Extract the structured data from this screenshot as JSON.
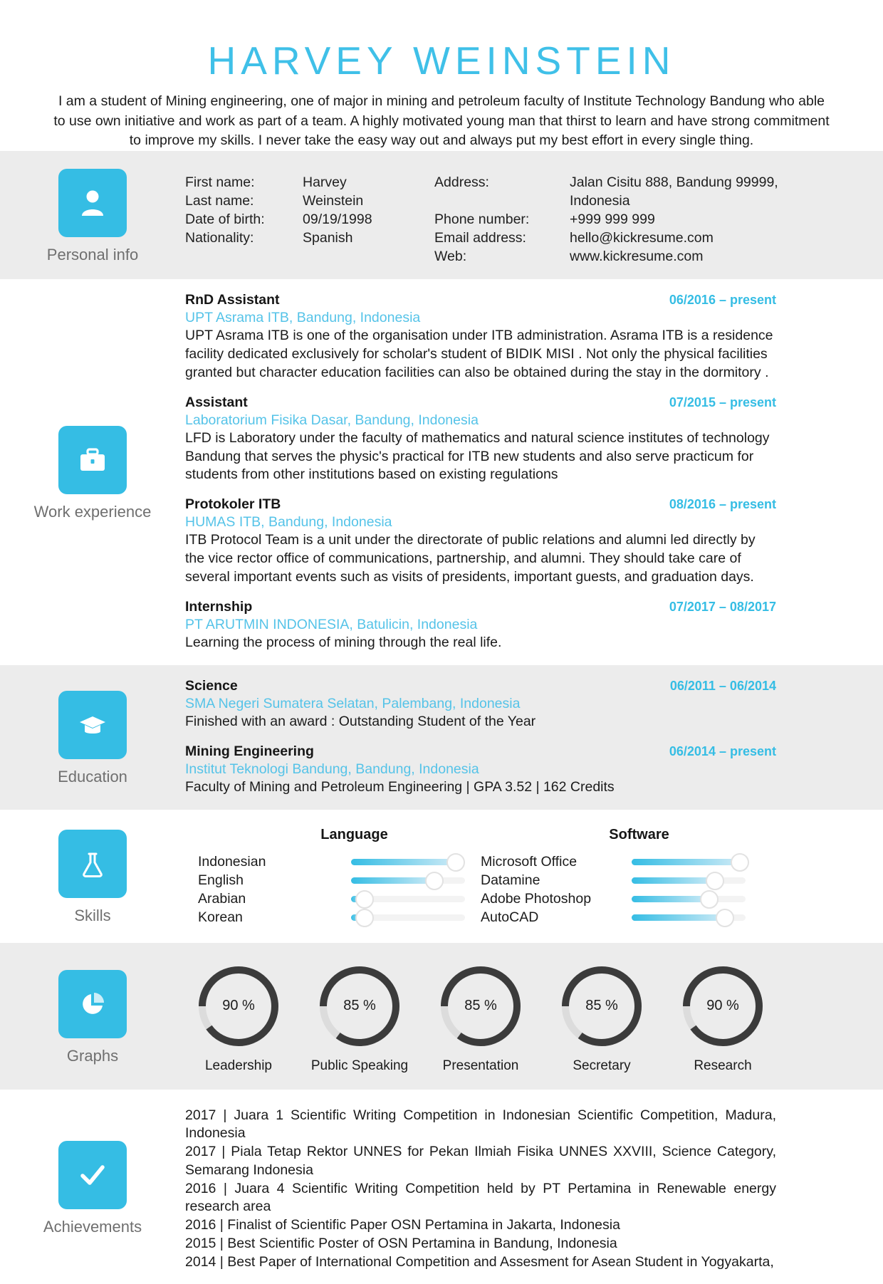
{
  "header": {
    "full_name": "HARVEY WEINSTEIN",
    "summary": "I am a student of Mining engineering, one of major in mining and petroleum faculty of Institute Technology Bandung who able to use own initiative and work as part of a team. A highly motivated young man that thirst to learn and have strong commitment to improve my skills. I never take the easy way out and always put my best effort in every single thing."
  },
  "accent_color": "#35bde4",
  "sections": {
    "personal_info": {
      "label": "Personal info",
      "icon": "person-icon",
      "left_labels": [
        "First name:",
        "Last name:",
        "Date of birth:",
        "Nationality:"
      ],
      "left_values": [
        "Harvey",
        "Weinstein",
        "09/19/1998",
        "Spanish"
      ],
      "right_labels": [
        "Address:",
        "",
        "Phone number:",
        "Email address:",
        "Web:"
      ],
      "right_values": [
        "Jalan Cisitu 888, Bandung 99999,",
        "Indonesia",
        "+999 999 999",
        "hello@kickresume.com",
        "www.kickresume.com"
      ]
    },
    "work_experience": {
      "label": "Work experience",
      "icon": "briefcase-icon",
      "entries": [
        {
          "title": "RnD Assistant",
          "date": "06/2016 – present",
          "org": "UPT Asrama ITB, Bandung, Indonesia",
          "desc": "UPT Asrama ITB is one of the organisation under ITB administration. Asrama ITB is a residence facility dedicated exclusively for scholar's student of BIDIK MISI . Not only the physical facilities granted but character education facilities can also be obtained during the stay in the dormitory ."
        },
        {
          "title": "Assistant",
          "date": "07/2015 – present",
          "org": "Laboratorium Fisika Dasar, Bandung, Indonesia",
          "desc": "LFD is Laboratory under the faculty of mathematics and natural science institutes of technology Bandung that serves the physic's practical for ITB new students and also serve practicum for students from other institutions based on existing regulations"
        },
        {
          "title": "Protokoler ITB",
          "date": "08/2016 – present",
          "org": "HUMAS ITB, Bandung, Indonesia",
          "desc": "ITB Protocol Team is a unit under the directorate of public relations and alumni led directly by the vice rector office of communications, partnership, and alumni. They should take care of several important events such as visits of presidents, important guests, and graduation days."
        },
        {
          "title": "Internship",
          "date": "07/2017 – 08/2017",
          "org": "PT ARUTMIN INDONESIA, Batulicin, Indonesia",
          "desc": "Learning the process of mining through the real life."
        }
      ]
    },
    "education": {
      "label": "Education",
      "icon": "graduation-cap-icon",
      "entries": [
        {
          "title": "Science",
          "date": "06/2011 – 06/2014",
          "org": "SMA Negeri Sumatera Selatan, Palembang, Indonesia",
          "desc": "Finished with an award : Outstanding Student of the Year"
        },
        {
          "title": "Mining Engineering",
          "date": "06/2014 – present",
          "org": "Institut Teknologi Bandung, Bandung, Indonesia",
          "desc": "Faculty of Mining and Petroleum Engineering | GPA 3.52 | 162 Credits"
        }
      ]
    },
    "skills": {
      "label": "Skills",
      "icon": "flask-icon",
      "groups": [
        {
          "heading": "Language",
          "items": [
            {
              "name": "Indonesian",
              "level": 92
            },
            {
              "name": "English",
              "level": 73
            },
            {
              "name": "Arabian",
              "level": 12
            },
            {
              "name": "Korean",
              "level": 12
            }
          ]
        },
        {
          "heading": "Software",
          "items": [
            {
              "name": "Microsoft Office",
              "level": 95
            },
            {
              "name": "Datamine",
              "level": 73
            },
            {
              "name": "Adobe Photoshop",
              "level": 68
            },
            {
              "name": "AutoCAD",
              "level": 82
            }
          ]
        }
      ]
    },
    "graphs": {
      "label": "Graphs",
      "icon": "pie-chart-icon",
      "items": [
        {
          "label": "Leadership",
          "value": 90,
          "value_text": "90 %"
        },
        {
          "label": "Public Speaking",
          "value": 85,
          "value_text": "85 %"
        },
        {
          "label": "Presentation",
          "value": 85,
          "value_text": "85 %"
        },
        {
          "label": "Secretary",
          "value": 85,
          "value_text": "85 %"
        },
        {
          "label": "Research",
          "value": 90,
          "value_text": "90 %"
        }
      ]
    },
    "achievements": {
      "label": "Achievements",
      "icon": "check-icon",
      "lines": [
        "2017 | Juara 1 Scientific Writing Competition in Indonesian Scientific Competition, Madura, Indonesia",
        "2017 | Piala Tetap Rektor UNNES for Pekan Ilmiah Fisika UNNES XXVIII, Science Category, Semarang Indonesia",
        "2016 | Juara 4 Scientific Writing Competition held by PT Pertamina in Renewable energy research area",
        "2016 | Finalist of Scientific Paper OSN Pertamina in Jakarta, Indonesia",
        "2015 | Best Scientific Poster of OSN Pertamina in Bandung, Indonesia",
        "2014 | Best Paper of International Competition and Assesment for Asean Student in Yogyakarta,"
      ]
    }
  },
  "chart_data": {
    "type": "pie",
    "title": "Graphs",
    "categories": [
      "Leadership",
      "Public Speaking",
      "Presentation",
      "Secretary",
      "Research"
    ],
    "values": [
      90,
      85,
      85,
      85,
      90
    ],
    "unit": "%",
    "ylim": [
      0,
      100
    ]
  }
}
